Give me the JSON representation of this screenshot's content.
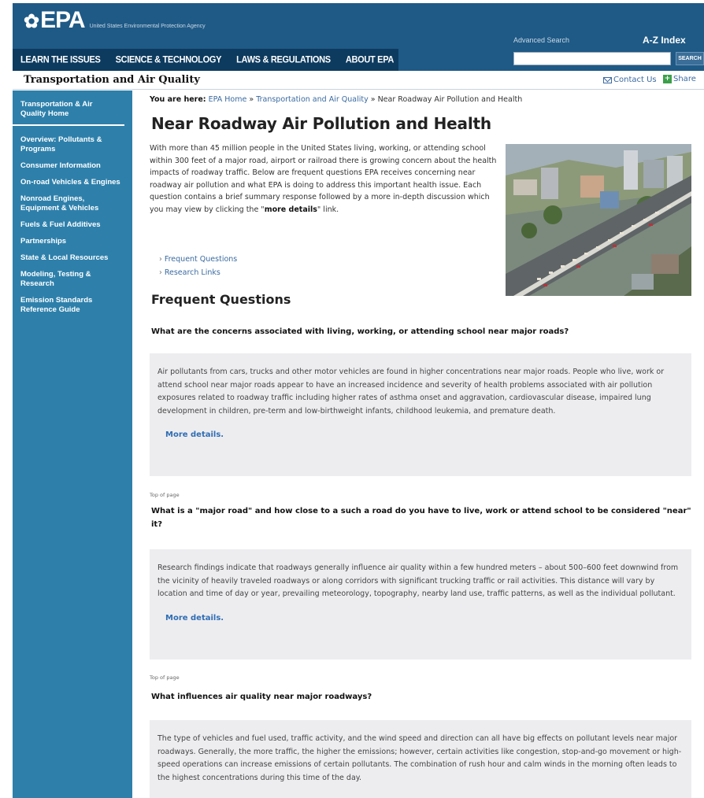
{
  "header": {
    "logo_text": "EPA",
    "agency_name": "United States Environmental Protection Agency",
    "nav": [
      "LEARN THE ISSUES",
      "SCIENCE & TECHNOLOGY",
      "LAWS & REGULATIONS",
      "ABOUT EPA"
    ],
    "advanced_search": "Advanced Search",
    "az_index": "A-Z Index",
    "search_placeholder": "",
    "search_button": "SEARCH"
  },
  "titlebar": {
    "site_title": "Transportation and Air Quality",
    "contact": "Contact Us",
    "share": "Share"
  },
  "sidebar": {
    "items": [
      "Transportation & Air Quality Home",
      "Overview: Pollutants & Programs",
      "Consumer Information",
      "On-road Vehicles & Engines",
      "Nonroad Engines, Equipment & Vehicles",
      "Fuels & Fuel Additives",
      "Partnerships",
      "State & Local Resources",
      "Modeling, Testing & Research",
      "Emission Standards Reference Guide"
    ]
  },
  "breadcrumb": {
    "label": "You are here:",
    "home": "EPA Home",
    "sep1": " » ",
    "section": "Transportation and Air Quality",
    "sep2": " » ",
    "current": "Near Roadway Air Pollution and Health"
  },
  "page": {
    "title": "Near Roadway Air Pollution and Health",
    "intro_before": "With more than 45 million people in the United States living, working, or attending school within 300 feet of a major road, airport or railroad there is growing concern about the health impacts of roadway traffic. Below are frequent questions EPA receives concerning near roadway air pollution and what EPA is doing to address this important health issue. Each question contains a brief summary response followed by a more in-depth discussion which you may view by clicking the \"",
    "intro_bold": "more details",
    "intro_after": "\" link.",
    "toc": [
      "Frequent Questions",
      "Research Links"
    ],
    "section_title": "Frequent Questions"
  },
  "faq": [
    {
      "question": "What are the concerns associated with living, working, or attending school near major roads?",
      "answer": "Air pollutants from cars, trucks and other motor vehicles are found in higher concentrations near major roads. People who live, work or attend school near major roads appear to have an increased incidence and severity of health problems associated with air pollution exposures related to roadway traffic including higher rates of asthma onset and aggravation, cardiovascular disease, impaired lung development in children, pre-term and low-birthweight infants, childhood leukemia, and premature death.",
      "more": "More details."
    },
    {
      "question": "What is a \"major road\" and how close to a such a road do you have to live, work or attend school to be considered \"near\" it?",
      "answer": "Research findings indicate that roadways generally influence air quality within a few hundred meters – about 500–600 feet downwind from the vicinity of heavily traveled roadways or along corridors with significant trucking traffic or rail activities. This distance will vary by location and time of day or year, prevailing meteorology, topography, nearby land use, traffic patterns, as well as the individual pollutant.",
      "more": "More details."
    },
    {
      "question": "What influences air quality near major roadways?",
      "answer": "The type of vehicles and fuel used, traffic activity, and the wind speed and direction can all have big effects on pollutant levels near major roadways. Generally, the more traffic, the higher the emissions; however, certain activities like congestion, stop-and-go movement or high-speed operations can increase emissions of certain pollutants. The combination of rush hour and calm winds in the morning often leads to the highest concentrations during this time of the day.",
      "more": ""
    }
  ],
  "top_of_page": "Top of page"
}
